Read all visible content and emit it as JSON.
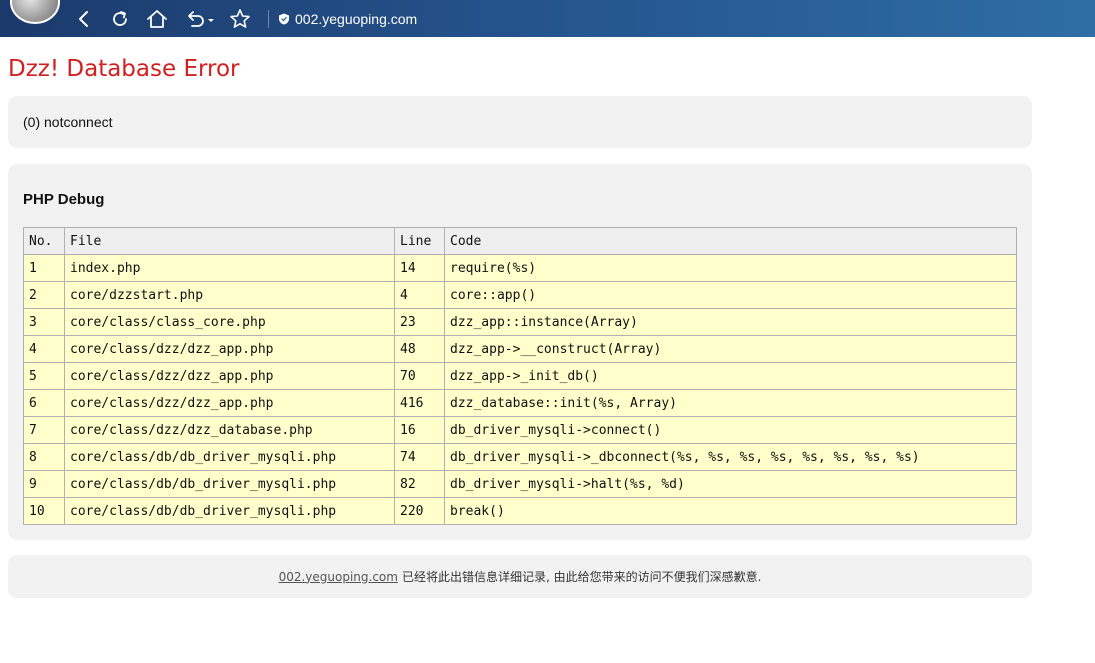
{
  "browser": {
    "url": "002.yeguoping.com",
    "icons": {
      "back": "chevron-left-icon",
      "refresh": "refresh-icon",
      "home": "home-icon",
      "undo": "undo-icon",
      "favorite": "star-icon",
      "security": "shield-icon"
    }
  },
  "page": {
    "title": "Dzz! Database Error",
    "message": "(0) notconnect",
    "debug_title": "PHP Debug",
    "table": {
      "headers": [
        "No.",
        "File",
        "Line",
        "Code"
      ],
      "rows": [
        [
          "1",
          "index.php",
          "14",
          "require(%s)"
        ],
        [
          "2",
          "core/dzzstart.php",
          "4",
          "core::app()"
        ],
        [
          "3",
          "core/class/class_core.php",
          "23",
          "dzz_app::instance(Array)"
        ],
        [
          "4",
          "core/class/dzz/dzz_app.php",
          "48",
          "dzz_app->__construct(Array)"
        ],
        [
          "5",
          "core/class/dzz/dzz_app.php",
          "70",
          "dzz_app->_init_db()"
        ],
        [
          "6",
          "core/class/dzz/dzz_app.php",
          "416",
          "dzz_database::init(%s, Array)"
        ],
        [
          "7",
          "core/class/dzz/dzz_database.php",
          "16",
          "db_driver_mysqli->connect()"
        ],
        [
          "8",
          "core/class/db/db_driver_mysqli.php",
          "74",
          "db_driver_mysqli->_dbconnect(%s, %s, %s, %s, %s, %s, %s, %s)"
        ],
        [
          "9",
          "core/class/db/db_driver_mysqli.php",
          "82",
          "db_driver_mysqli->halt(%s, %d)"
        ],
        [
          "10",
          "core/class/db/db_driver_mysqli.php",
          "220",
          "break()"
        ]
      ]
    },
    "footer": {
      "link": "002.yeguoping.com",
      "text": "已经将此出错信息详细记录, 由此给您带来的访问不便我们深感歉意."
    }
  },
  "colors": {
    "title_red": "#d31f1f",
    "row_yellow": "#ffffcc",
    "box_gray": "#f2f2f2"
  }
}
